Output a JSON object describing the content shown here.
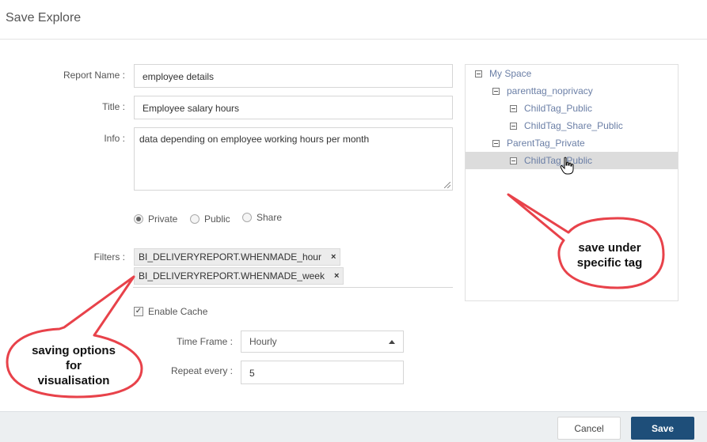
{
  "dialog": {
    "title": "Save Explore"
  },
  "form": {
    "report_name": {
      "label": "Report Name :",
      "value": "employee details"
    },
    "title": {
      "label": "Title :",
      "value": "Employee salary hours"
    },
    "info": {
      "label": "Info :",
      "value": "data depending on employee working hours per month"
    },
    "visibility": {
      "options": [
        "Private",
        "Public",
        "Share"
      ],
      "selected": "Private"
    },
    "filters": {
      "label": "Filters :",
      "chips": [
        "BI_DELIVERYREPORT.WHENMADE_hour",
        "BI_DELIVERYREPORT.WHENMADE_week"
      ],
      "remove_glyph": "×"
    },
    "enable_cache": {
      "label": "Enable Cache",
      "checked": true
    },
    "time_frame": {
      "label": "Time Frame :",
      "value": "Hourly"
    },
    "repeat_every": {
      "label": "Repeat every :",
      "value": "5"
    }
  },
  "tree": {
    "root": "My Space",
    "nodes": [
      {
        "label": "parenttag_noprivacy",
        "level": 1
      },
      {
        "label": "ChildTag_Public",
        "level": 2
      },
      {
        "label": "ChildTag_Share_Public",
        "level": 2
      },
      {
        "label": "ParentTag_Private",
        "level": 1
      },
      {
        "label": "ChildTag_Public",
        "level": 2,
        "selected": true
      }
    ]
  },
  "annotations": {
    "tree_callout": [
      "save under",
      "specific tag"
    ],
    "options_callout": [
      "saving options",
      "for",
      "visualisation"
    ]
  },
  "footer": {
    "cancel_label": "Cancel",
    "save_label": "Save"
  },
  "colors": {
    "accent": "#1e4e79",
    "callout_border": "#e8424a",
    "tree_text": "#6b7fa6"
  }
}
